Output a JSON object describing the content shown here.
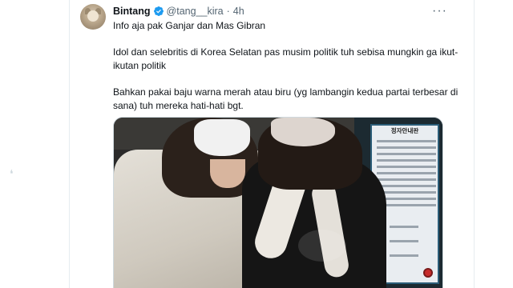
{
  "tweet": {
    "display_name": "Bintang",
    "handle": "@tang__kira",
    "separator": "·",
    "time": "4h",
    "more_label": "···",
    "text_1": "Info aja pak Ganjar dan Mas Gibran",
    "text_2": "Idol dan selebritis di Korea Selatan pas musim politik tuh sebisa  mungkin ga ikut-ikutan politik",
    "text_3": "Bahkan pakai baju warna merah atau biru (yg lambangin kedua partai terbesar di sana) tuh mereka hati-hati bgt.",
    "sign_title": "정자안내판"
  },
  "icons": {
    "avatar": "avatar-cat",
    "verified": "verified-badge-icon",
    "more": "more-options-icon"
  },
  "colors": {
    "verified_blue": "#1d9bf0",
    "text_primary": "#0f1419",
    "text_secondary": "#536471",
    "border": "#e6ecf0"
  }
}
